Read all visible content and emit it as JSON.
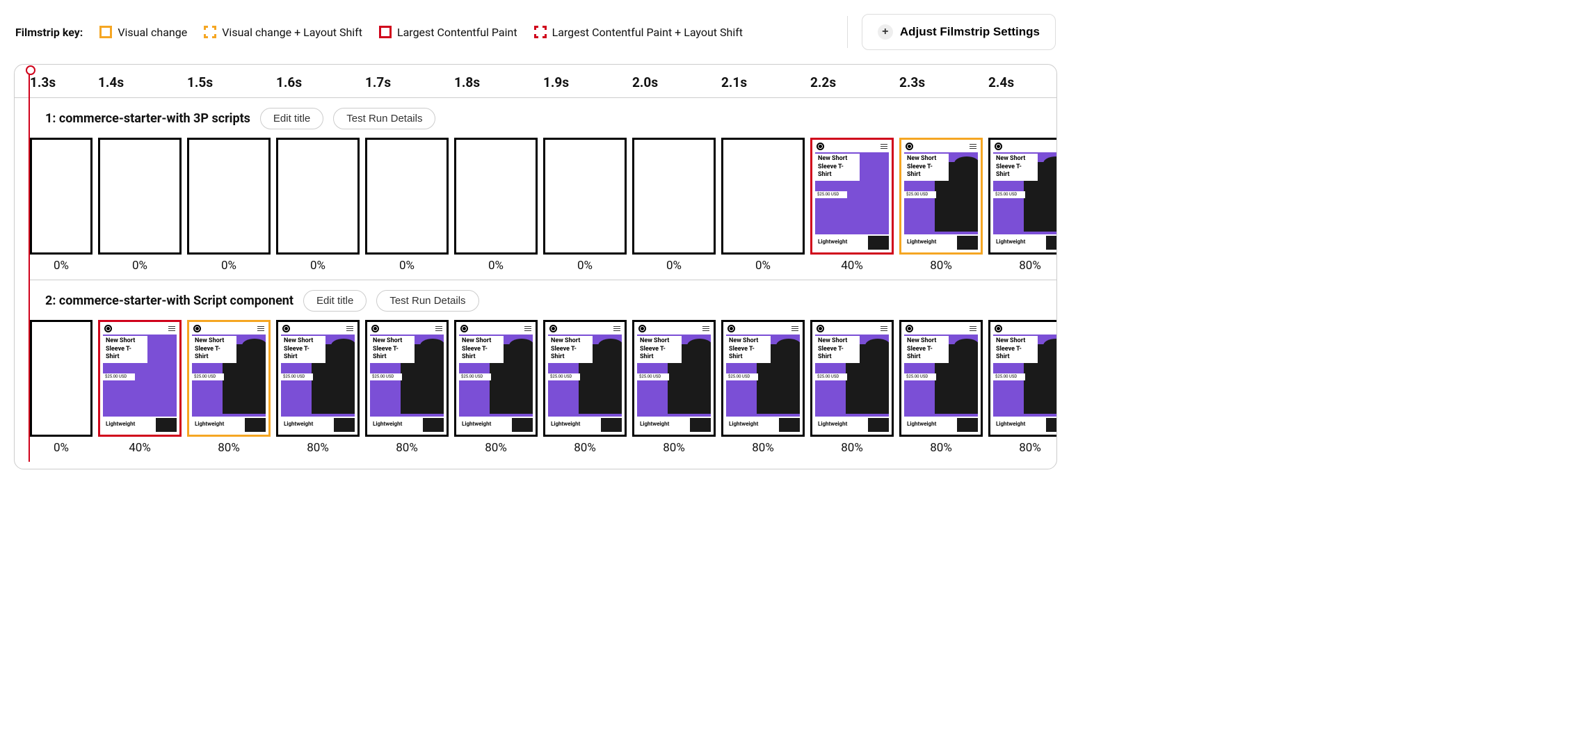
{
  "legend": {
    "title": "Filmstrip key:",
    "items": [
      {
        "label": "Visual change"
      },
      {
        "label": "Visual change + Layout Shift"
      },
      {
        "label": "Largest Contentful Paint"
      },
      {
        "label": "Largest Contentful Paint + Layout Shift"
      }
    ]
  },
  "adjust_button": "Adjust Filmstrip Settings",
  "times": [
    "1.3s",
    "1.4s",
    "1.5s",
    "1.6s",
    "1.7s",
    "1.8s",
    "1.9s",
    "2.0s",
    "2.1s",
    "2.2s",
    "2.3s",
    "2.4s"
  ],
  "product": {
    "title": "New Short Sleeve T-Shirt",
    "price": "$25.00 USD",
    "tag": "Lightweight"
  },
  "tests": [
    {
      "title": "1: commerce-starter-with 3P scripts",
      "edit": "Edit title",
      "details": "Test Run Details",
      "frames": [
        {
          "pct": "0%",
          "state": "empty",
          "border": "black"
        },
        {
          "pct": "0%",
          "state": "empty",
          "border": "black"
        },
        {
          "pct": "0%",
          "state": "empty",
          "border": "black"
        },
        {
          "pct": "0%",
          "state": "empty",
          "border": "black"
        },
        {
          "pct": "0%",
          "state": "empty",
          "border": "black"
        },
        {
          "pct": "0%",
          "state": "empty",
          "border": "black"
        },
        {
          "pct": "0%",
          "state": "empty",
          "border": "black"
        },
        {
          "pct": "0%",
          "state": "empty",
          "border": "black"
        },
        {
          "pct": "0%",
          "state": "empty",
          "border": "black"
        },
        {
          "pct": "40%",
          "state": "noshirt",
          "border": "red"
        },
        {
          "pct": "80%",
          "state": "full",
          "border": "orange"
        },
        {
          "pct": "80%",
          "state": "full",
          "border": "black"
        }
      ]
    },
    {
      "title": "2: commerce-starter-with Script component",
      "edit": "Edit title",
      "details": "Test Run Details",
      "frames": [
        {
          "pct": "0%",
          "state": "empty",
          "border": "black"
        },
        {
          "pct": "40%",
          "state": "noshirt",
          "border": "red"
        },
        {
          "pct": "80%",
          "state": "full",
          "border": "orange"
        },
        {
          "pct": "80%",
          "state": "full",
          "border": "black"
        },
        {
          "pct": "80%",
          "state": "full",
          "border": "black"
        },
        {
          "pct": "80%",
          "state": "full",
          "border": "black"
        },
        {
          "pct": "80%",
          "state": "full",
          "border": "black"
        },
        {
          "pct": "80%",
          "state": "full",
          "border": "black"
        },
        {
          "pct": "80%",
          "state": "full",
          "border": "black"
        },
        {
          "pct": "80%",
          "state": "full",
          "border": "black"
        },
        {
          "pct": "80%",
          "state": "full",
          "border": "black"
        },
        {
          "pct": "80%",
          "state": "full",
          "border": "black"
        }
      ]
    }
  ]
}
